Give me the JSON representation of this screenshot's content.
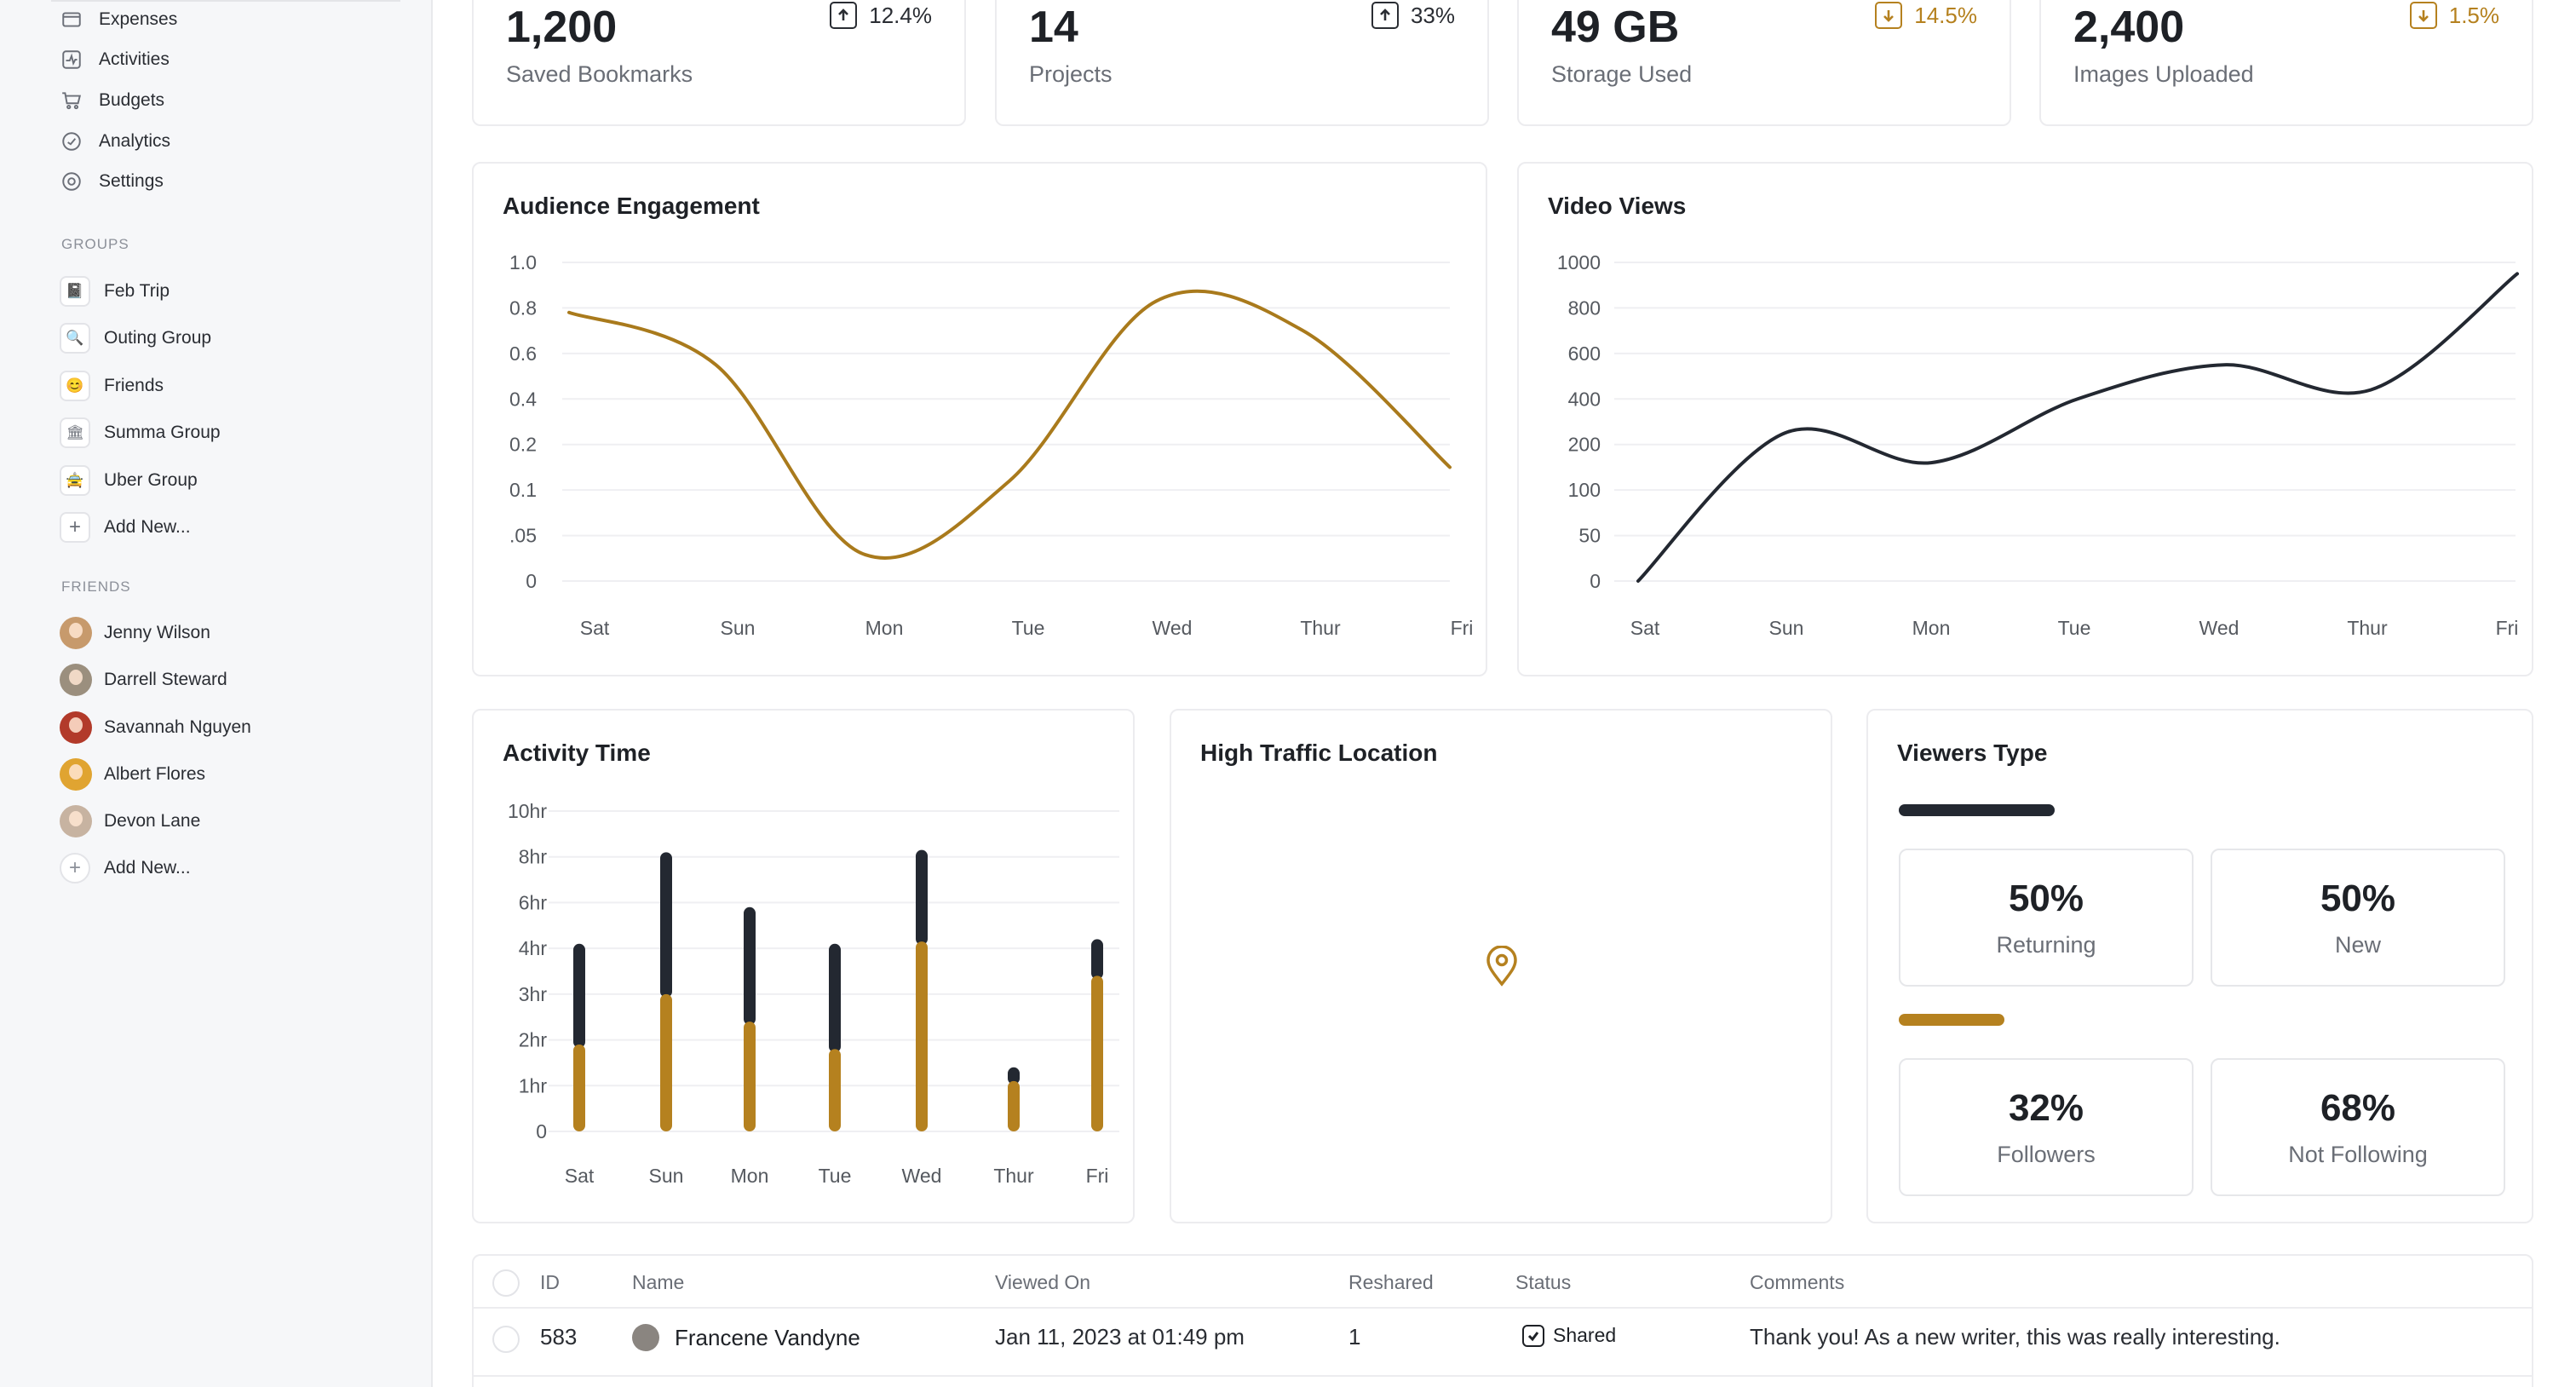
{
  "colors": {
    "gold": "#b5811f",
    "dark": "#232831",
    "brown_line": "#a97a1c"
  },
  "sidebar": {
    "nav": [
      {
        "label": "Expenses",
        "icon": "wallet-icon"
      },
      {
        "label": "Activities",
        "icon": "activity-icon"
      },
      {
        "label": "Budgets",
        "icon": "cart-icon"
      },
      {
        "label": "Analytics",
        "icon": "analytics-icon"
      },
      {
        "label": "Settings",
        "icon": "gear-icon"
      }
    ],
    "groups_heading": "GROUPS",
    "groups": [
      {
        "label": "Feb Trip",
        "icon": "📓"
      },
      {
        "label": "Outing Group",
        "icon": "🔍"
      },
      {
        "label": "Friends",
        "icon": "😊"
      },
      {
        "label": "Summa Group",
        "icon": "🏛"
      },
      {
        "label": "Uber Group",
        "icon": "🚖"
      },
      {
        "label": "Add New...",
        "icon": "+"
      }
    ],
    "friends_heading": "FRIENDS",
    "friends": [
      {
        "label": "Jenny Wilson",
        "color": "#c79a6c"
      },
      {
        "label": "Darrell Steward",
        "color": "#9b8f7e"
      },
      {
        "label": "Savannah Nguyen",
        "color": "#b23a2a"
      },
      {
        "label": "Albert Flores",
        "color": "#e0a431"
      },
      {
        "label": "Devon Lane",
        "color": "#c7b3a1"
      },
      {
        "label": "Add New...",
        "color": ""
      }
    ]
  },
  "stats": [
    {
      "value": "1,200",
      "label": "Saved Bookmarks",
      "change": "12.4%",
      "direction": "up",
      "color": "#2a2d33"
    },
    {
      "value": "14",
      "label": "Projects",
      "change": "33%",
      "direction": "up",
      "color": "#2a2d33"
    },
    {
      "value": "49 GB",
      "label": "Storage Used",
      "change": "14.5%",
      "direction": "down",
      "color": "#b5811f"
    },
    {
      "value": "2,400",
      "label": "Images Uploaded",
      "change": "1.5%",
      "direction": "down",
      "color": "#b5811f"
    }
  ],
  "chart_data": [
    {
      "type": "line",
      "title": "Audience Engagement",
      "categories": [
        "Sat",
        "Sun",
        "Mon",
        "Tue",
        "Wed",
        "Thur",
        "Fri"
      ],
      "y_ticks": [
        "1.0",
        "0.8",
        "0.6",
        "0.4",
        "0.2",
        "0.1",
        ".05",
        "0"
      ],
      "series": [
        {
          "values": [
            0.78,
            0.55,
            0.03,
            0.12,
            0.83,
            0.7,
            0.15
          ]
        }
      ],
      "grid": true
    },
    {
      "type": "line",
      "title": "Video Views",
      "categories": [
        "Sat",
        "Sun",
        "Mon",
        "Tue",
        "Wed",
        "Thur",
        "Fri"
      ],
      "y_ticks": [
        "1000",
        "800",
        "600",
        "400",
        "200",
        "100",
        "50",
        "0"
      ],
      "series": [
        {
          "values": [
            0,
            250,
            160,
            400,
            550,
            440,
            950
          ]
        }
      ],
      "grid": true
    },
    {
      "type": "bar",
      "title": "Activity Time",
      "categories": [
        "Sat",
        "Sun",
        "Mon",
        "Tue",
        "Wed",
        "Thur",
        "Fri"
      ],
      "y_ticks": [
        "10hr",
        "8hr",
        "6hr",
        "4hr",
        "3hr",
        "2hr",
        "1hr",
        "0"
      ],
      "stacked": true,
      "series": [
        {
          "values": [
            1.9,
            3.0,
            2.4,
            1.8,
            4.3,
            1.1,
            3.4
          ],
          "color": "#b5811f"
        },
        {
          "values": [
            2.3,
            5.2,
            3.4,
            2.4,
            4.0,
            0.3,
            1.0
          ],
          "color": "#232831"
        }
      ],
      "grid": true
    }
  ],
  "map": {
    "title": "High Traffic Location",
    "pin": "location-pin-icon"
  },
  "viewers": {
    "title": "Viewers Type",
    "boxes": [
      {
        "pct": "50%",
        "label": "Returning"
      },
      {
        "pct": "50%",
        "label": "New"
      },
      {
        "pct": "32%",
        "label": "Followers"
      },
      {
        "pct": "68%",
        "label": "Not Following"
      }
    ],
    "bar1_fill": 0.5,
    "bar2_fill": 0.32
  },
  "table": {
    "headers": [
      "ID",
      "Name",
      "Viewed On",
      "Reshared",
      "Status",
      "Comments"
    ],
    "rows": [
      {
        "id": "583",
        "name": "Francene Vandyne",
        "viewed": "Jan 11, 2023 at 01:49 pm",
        "reshared": "1",
        "status": "Shared",
        "comment": "Thank you! As a new writer, this was really interesting."
      }
    ]
  }
}
